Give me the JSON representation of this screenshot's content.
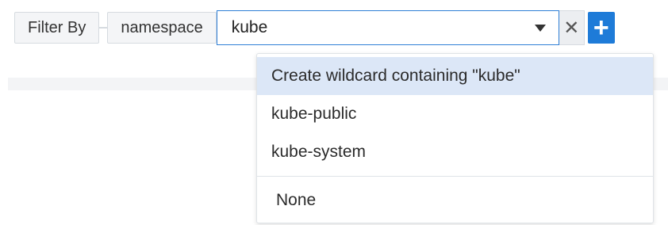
{
  "filter": {
    "label": "Filter By",
    "field": "namespace",
    "value": "kube",
    "clear_glyph": "✕",
    "add_glyph": "+"
  },
  "dropdown": {
    "options": [
      "Create wildcard containing \"kube\"",
      "kube-public",
      "kube-system"
    ],
    "none_label": "None"
  },
  "colors": {
    "accent": "#1e7bd8",
    "highlight": "#dce7f7"
  }
}
